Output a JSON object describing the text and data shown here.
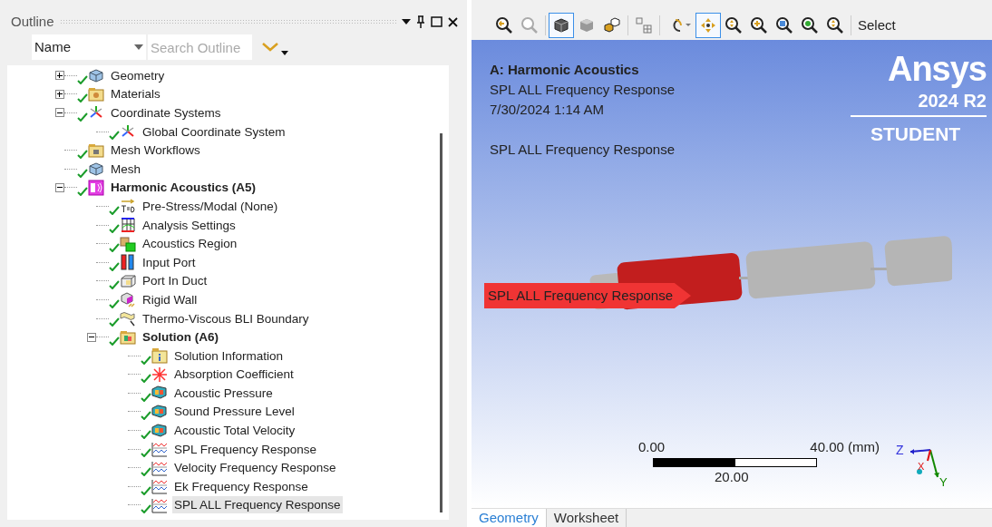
{
  "outline": {
    "title": "Outline",
    "filter": {
      "value": "Name",
      "placeholder": "Search Outline"
    },
    "tree": [
      {
        "label": "Geometry",
        "kind": "geometry",
        "expanded": false,
        "selected": false
      },
      {
        "label": "Materials",
        "kind": "materials",
        "expanded": false,
        "selected": false
      },
      {
        "label": "Coordinate Systems",
        "kind": "coords",
        "expanded": true,
        "selected": false,
        "children": [
          {
            "label": "Global Coordinate System",
            "kind": "coords",
            "selected": false
          }
        ]
      },
      {
        "label": "Mesh Workflows",
        "kind": "folder",
        "selected": false
      },
      {
        "label": "Mesh",
        "kind": "geometry",
        "selected": false
      },
      {
        "label": "Harmonic Acoustics (A5)",
        "kind": "analysis",
        "bold": true,
        "expanded": true,
        "selected": false,
        "children": [
          {
            "label": "Pre-Stress/Modal (None)",
            "kind": "tzero",
            "selected": false
          },
          {
            "label": "Analysis Settings",
            "kind": "settings",
            "selected": false
          },
          {
            "label": "Acoustics Region",
            "kind": "region",
            "selected": false
          },
          {
            "label": "Input Port",
            "kind": "port",
            "selected": false
          },
          {
            "label": "Port In Duct",
            "kind": "duct",
            "selected": false
          },
          {
            "label": "Rigid Wall",
            "kind": "wall",
            "selected": false
          },
          {
            "label": "Thermo-Viscous BLI Boundary",
            "kind": "bli",
            "selected": false
          },
          {
            "label": "Solution (A6)",
            "kind": "solution",
            "bold": true,
            "expanded": true,
            "selected": false,
            "children": [
              {
                "label": "Solution Information",
                "kind": "info",
                "selected": false
              },
              {
                "label": "Absorption Coefficient",
                "kind": "absorption",
                "selected": false
              },
              {
                "label": "Acoustic Pressure",
                "kind": "result",
                "selected": false
              },
              {
                "label": "Sound Pressure Level",
                "kind": "result",
                "selected": false
              },
              {
                "label": "Acoustic Total Velocity",
                "kind": "result",
                "selected": false
              },
              {
                "label": "SPL Frequency Response",
                "kind": "chart",
                "selected": false
              },
              {
                "label": "Velocity Frequency Response",
                "kind": "chart",
                "selected": false
              },
              {
                "label": "Ek Frequency Response",
                "kind": "chart",
                "selected": false
              },
              {
                "label": "SPL ALL Frequency Response",
                "kind": "chart",
                "selected": true
              }
            ]
          }
        ]
      }
    ]
  },
  "toolbar": {
    "buttons": [
      {
        "kind": "zoom-back",
        "active": false
      },
      {
        "kind": "zoom-forward",
        "active": false
      },
      {
        "kind": "sep"
      },
      {
        "kind": "cube",
        "active": true
      },
      {
        "kind": "cube-solid",
        "active": false
      },
      {
        "kind": "parts",
        "active": false
      },
      {
        "kind": "sep"
      },
      {
        "kind": "grid",
        "active": false
      },
      {
        "kind": "sep"
      },
      {
        "kind": "rotate",
        "active": false
      },
      {
        "kind": "pan",
        "active": true
      },
      {
        "kind": "zoom",
        "active": false
      },
      {
        "kind": "zoom-plus",
        "active": false
      },
      {
        "kind": "zoom-box",
        "active": false
      },
      {
        "kind": "zoom-fit",
        "active": false
      },
      {
        "kind": "zoom",
        "active": false
      },
      {
        "kind": "sep"
      }
    ],
    "select_label": "Select"
  },
  "viewport": {
    "title": "A: Harmonic Acoustics",
    "lines": [
      "SPL ALL Frequency Response",
      "7/30/2024 1:14 AM"
    ],
    "caption": "SPL ALL Frequency Response",
    "logo": {
      "name": "Ansys",
      "version": "2024 R2",
      "edition": "STUDENT"
    },
    "result_label": "SPL ALL Frequency Response",
    "scale": {
      "start": "0.00",
      "end": "40.00 (mm)",
      "middle": "20.00"
    },
    "triad": {
      "z": "Z",
      "x": "X",
      "y": "Y"
    }
  },
  "tabs": [
    {
      "label": "Geometry",
      "selected": true
    },
    {
      "label": "Worksheet",
      "selected": false
    }
  ]
}
